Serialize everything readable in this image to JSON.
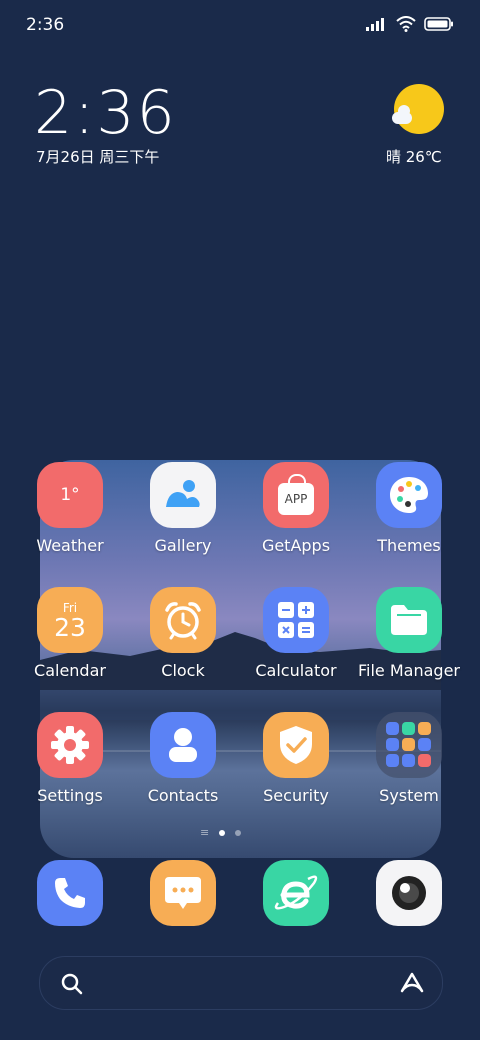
{
  "status": {
    "time": "2:36"
  },
  "clock": {
    "time": "2:36",
    "date": "7月26日 周三下午"
  },
  "weather": {
    "text": "晴 26℃"
  },
  "apps": [
    {
      "label": "Weather",
      "icon": "weather-icon",
      "badge": "1°",
      "color": "#f26b6b"
    },
    {
      "label": "Gallery",
      "icon": "gallery-icon",
      "color": "#f4f4f6"
    },
    {
      "label": "GetApps",
      "icon": "getapps-icon",
      "badge": "APP",
      "color": "#f26b6b"
    },
    {
      "label": "Themes",
      "icon": "themes-icon",
      "color": "#5b82f5"
    },
    {
      "label": "Calendar",
      "icon": "calendar-icon",
      "day": "Fri",
      "date": "23",
      "color": "#f7ad55"
    },
    {
      "label": "Clock",
      "icon": "clock-icon",
      "color": "#f7ad55"
    },
    {
      "label": "Calculator",
      "icon": "calculator-icon",
      "color": "#5b82f5"
    },
    {
      "label": "File Manager",
      "icon": "folder-icon",
      "color": "#39d6a4"
    },
    {
      "label": "Settings",
      "icon": "gear-icon",
      "color": "#f26b6b"
    },
    {
      "label": "Contacts",
      "icon": "contacts-icon",
      "color": "#5b82f5"
    },
    {
      "label": "Security",
      "icon": "shield-icon",
      "color": "#f7ad55"
    },
    {
      "label": "System",
      "icon": "folder-grid-icon",
      "color": "#4a5773"
    }
  ],
  "dock": [
    {
      "icon": "phone-icon",
      "color": "#5b82f5"
    },
    {
      "icon": "messages-icon",
      "color": "#f7ad55"
    },
    {
      "icon": "browser-icon",
      "color": "#39d6a4"
    },
    {
      "icon": "camera-icon",
      "color": "#f4f4f6"
    }
  ]
}
